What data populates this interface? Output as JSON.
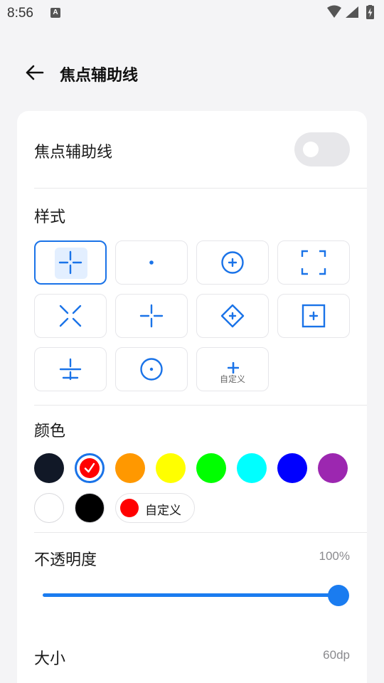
{
  "status_bar": {
    "time": "8:56",
    "notification_icon": "A"
  },
  "header": {
    "title": "焦点辅助线",
    "back_icon": "arrow-left-icon"
  },
  "settings": {
    "focus_guide": {
      "label": "焦点辅助线",
      "enabled": false
    },
    "style": {
      "label": "样式",
      "selected_index": 0,
      "options": [
        {
          "icon": "crosshair-gap-icon"
        },
        {
          "icon": "center-dot-icon"
        },
        {
          "icon": "circle-plus-icon"
        },
        {
          "icon": "corner-brackets-icon"
        },
        {
          "icon": "diagonal-x-icon"
        },
        {
          "icon": "cross-gap-icon"
        },
        {
          "icon": "diamond-plus-icon"
        },
        {
          "icon": "square-plus-icon"
        },
        {
          "icon": "horizon-lines-icon"
        },
        {
          "icon": "circle-dot-icon"
        },
        {
          "icon": "custom-plus-icon",
          "label": "自定义"
        }
      ]
    },
    "color": {
      "label": "颜色",
      "selected_index": 1,
      "swatches": [
        "#111827",
        "#ff0000",
        "#ff9800",
        "#ffff00",
        "#00ff00",
        "#00ffff",
        "#0000ff",
        "#9c27b0",
        "#ffffff",
        "#000000"
      ],
      "custom": {
        "label": "自定义",
        "color": "#ff0000"
      }
    },
    "opacity": {
      "label": "不透明度",
      "value": "100%",
      "fraction": 1.0
    },
    "size": {
      "label": "大小",
      "value": "60dp"
    }
  },
  "accent_color": "#1a73e8"
}
